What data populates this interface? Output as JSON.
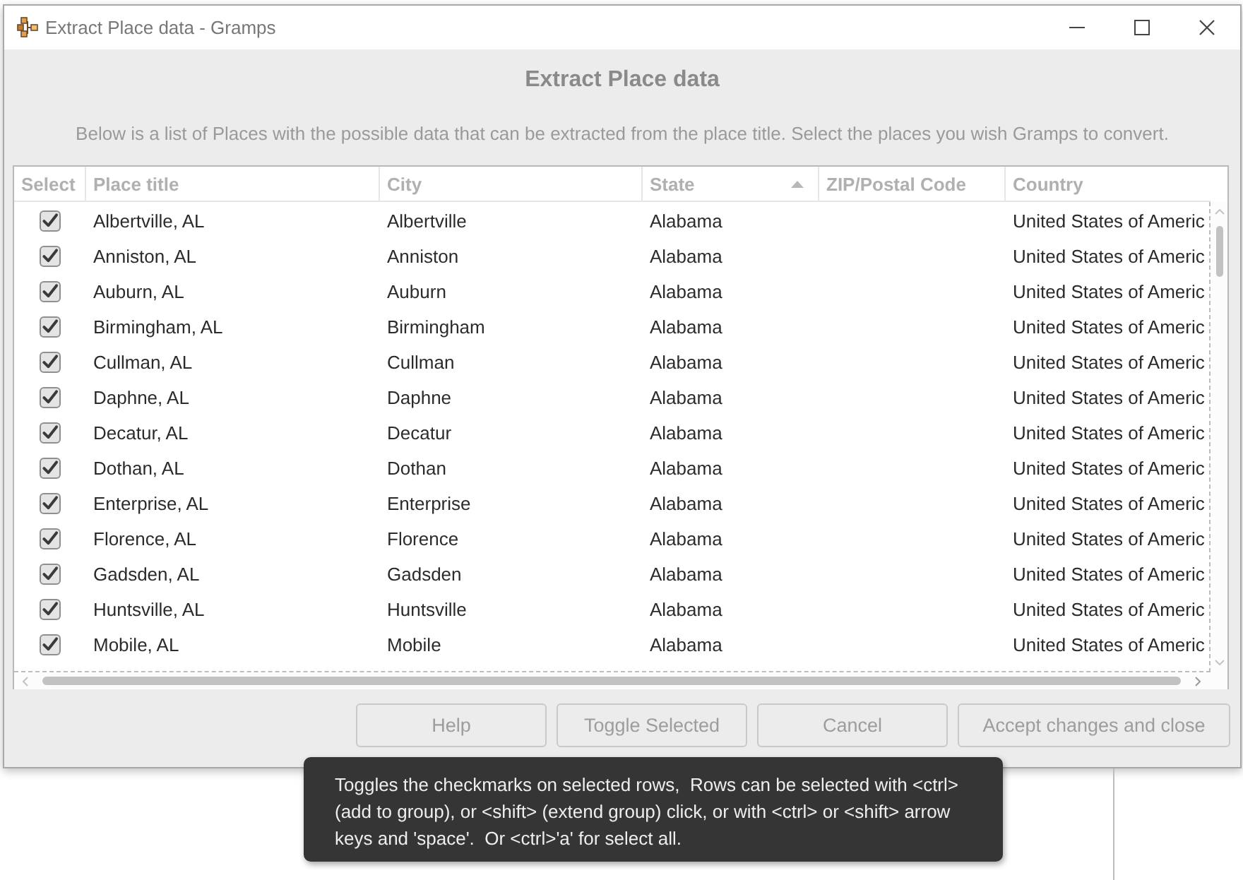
{
  "window": {
    "title": "Extract Place data - Gramps"
  },
  "header": {
    "heading": "Extract Place data",
    "description": "Below is a list of Places with the possible data that can be extracted from the place title. Select the places you wish Gramps to convert."
  },
  "table": {
    "columns": [
      {
        "label": "Select",
        "sorted": false
      },
      {
        "label": "Place title",
        "sorted": false
      },
      {
        "label": "City",
        "sorted": false
      },
      {
        "label": "State",
        "sorted": true,
        "ascending": true
      },
      {
        "label": "ZIP/Postal Code",
        "sorted": false
      },
      {
        "label": "Country",
        "sorted": false
      }
    ],
    "rows": [
      {
        "checked": true,
        "place_title": "Albertville, AL",
        "city": "Albertville",
        "state": "Alabama",
        "country": "United States of Americ"
      },
      {
        "checked": true,
        "place_title": "Anniston, AL",
        "city": "Anniston",
        "state": "Alabama",
        "country": "United States of Americ"
      },
      {
        "checked": true,
        "place_title": "Auburn, AL",
        "city": "Auburn",
        "state": "Alabama",
        "country": "United States of Americ"
      },
      {
        "checked": true,
        "place_title": "Birmingham, AL",
        "city": "Birmingham",
        "state": "Alabama",
        "country": "United States of Americ"
      },
      {
        "checked": true,
        "place_title": "Cullman, AL",
        "city": "Cullman",
        "state": "Alabama",
        "country": "United States of Americ"
      },
      {
        "checked": true,
        "place_title": "Daphne, AL",
        "city": "Daphne",
        "state": "Alabama",
        "country": "United States of Americ"
      },
      {
        "checked": true,
        "place_title": "Decatur, AL",
        "city": "Decatur",
        "state": "Alabama",
        "country": "United States of Americ"
      },
      {
        "checked": true,
        "place_title": "Dothan, AL",
        "city": "Dothan",
        "state": "Alabama",
        "country": "United States of Americ"
      },
      {
        "checked": true,
        "place_title": "Enterprise, AL",
        "city": "Enterprise",
        "state": "Alabama",
        "country": "United States of Americ"
      },
      {
        "checked": true,
        "place_title": "Florence, AL",
        "city": "Florence",
        "state": "Alabama",
        "country": "United States of Americ"
      },
      {
        "checked": true,
        "place_title": "Gadsden, AL",
        "city": "Gadsden",
        "state": "Alabama",
        "country": "United States of Americ"
      },
      {
        "checked": true,
        "place_title": "Huntsville, AL",
        "city": "Huntsville",
        "state": "Alabama",
        "country": "United States of Americ"
      },
      {
        "checked": true,
        "place_title": "Mobile, AL",
        "city": "Mobile",
        "state": "Alabama",
        "country": "United States of Americ"
      }
    ]
  },
  "buttons": [
    {
      "label": "Help"
    },
    {
      "label": "Toggle Selected"
    },
    {
      "label": "Cancel"
    },
    {
      "label": "Accept changes and close"
    }
  ],
  "tooltip": {
    "text": "Toggles the checkmarks on selected rows,  Rows can be selected with <ctrl>\n(add to group), or <shift> (extend group) click, or with <ctrl> or <shift> arrow\nkeys and 'space'.  Or <ctrl>'a' for select all."
  }
}
